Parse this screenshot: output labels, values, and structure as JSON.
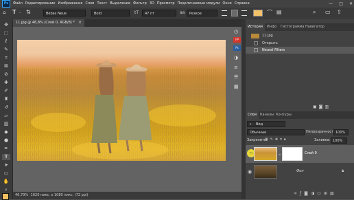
{
  "app": {
    "logo": "Ps"
  },
  "menu": [
    "Файл",
    "Редактирование",
    "Изображение",
    "Слои",
    "Текст",
    "Выделение",
    "Фильтр",
    "3D",
    "Просмотр",
    "Подключаемые модули",
    "Окно",
    "Справка"
  ],
  "window_controls": [
    "—",
    "□",
    "✕"
  ],
  "options": {
    "font_family": "Bebas Neue",
    "font_style": "Bold",
    "size_icon": "tT",
    "font_size": "47 пт",
    "aa_icon": "aa",
    "antialias": "Резкое",
    "text_color": "#f2c26b"
  },
  "document_tab": {
    "title": "11.jpg @ 46,8% (Слой 0, RGB/8) *",
    "close": "×"
  },
  "status": {
    "zoom": "46,79%",
    "info": "1620 пикс. x 1080 пикс. (72 ppi)"
  },
  "side_badges": [
    "FP",
    "Ps"
  ],
  "history_panel": {
    "tabs": [
      "История",
      "Инфо",
      "Гистограмма",
      "Навигатор"
    ],
    "snapshot": "11.jpg",
    "items": [
      "Открыть",
      "Neural Filters"
    ]
  },
  "layers_panel": {
    "tabs": [
      "Слои",
      "Каналы",
      "Контуры"
    ],
    "filter_label": "Вид",
    "blend_mode": "Обычные",
    "opacity_label": "Непрозрачность:",
    "opacity_value": "100%",
    "lock_label": "Закрепить:",
    "fill_label": "Заливка:",
    "fill_value": "100%",
    "layers": [
      {
        "name": "Слой 0",
        "selected": true
      },
      {
        "name": "Фон",
        "selected": false
      }
    ]
  }
}
